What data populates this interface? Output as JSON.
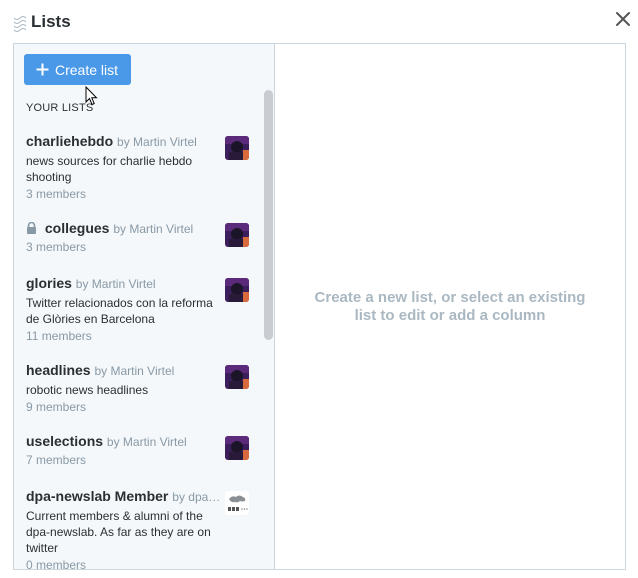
{
  "modal": {
    "title": "Lists",
    "drag_icon": "drag-handle-icon",
    "close_icon": "close-icon"
  },
  "toolbar": {
    "create_label": "Create list",
    "create_icon": "plus-icon"
  },
  "section": {
    "your_lists": "YOUR LISTS"
  },
  "lists": [
    {
      "name": "charliehebdo",
      "by": "by Martin Virtel",
      "description": "news sources for charlie hebdo shooting",
      "members": "3 members",
      "private": false,
      "avatar": "user-avatar"
    },
    {
      "name": "collegues",
      "by": "by Martin Virtel",
      "description": "",
      "members": "3 members",
      "private": true,
      "avatar": "user-avatar"
    },
    {
      "name": "glories",
      "by": "by Martin Virtel",
      "description": "Twitter relacionados con la reforma de Glòries en Barcelona",
      "members": "11 members",
      "private": false,
      "avatar": "user-avatar"
    },
    {
      "name": "headlines",
      "by": "by Martin Virtel",
      "description": "robotic news headlines",
      "members": "9 members",
      "private": false,
      "avatar": "user-avatar"
    },
    {
      "name": "uselections",
      "by": "by Martin Virtel",
      "description": "",
      "members": "7 members",
      "private": false,
      "avatar": "user-avatar"
    },
    {
      "name": "dpa-newslab Member",
      "by": "by dpa…",
      "description": "Current members & alumni of the dpa-newslab. As far as they are on twitter",
      "members": "0 members",
      "private": false,
      "avatar": "dpa-logo"
    }
  ],
  "detail": {
    "empty_message": "Create a new list, or select an existing list to edit or add a column"
  },
  "colors": {
    "accent": "#4a99e9",
    "muted": "#8899a6",
    "placeholder": "#aab8c2"
  }
}
